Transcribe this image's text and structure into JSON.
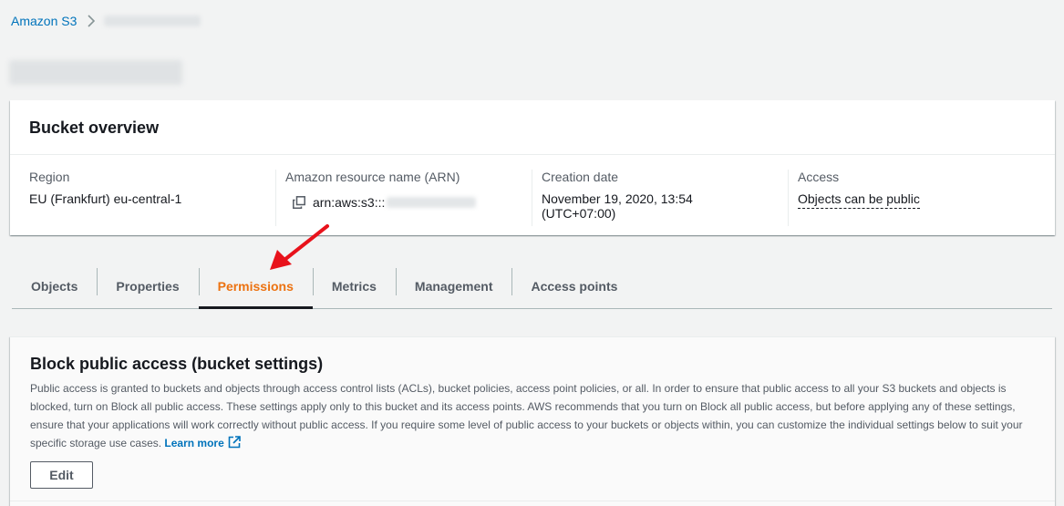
{
  "breadcrumb": {
    "root": "Amazon S3"
  },
  "overview": {
    "title": "Bucket overview",
    "region_label": "Region",
    "region_value": "EU (Frankfurt) eu-central-1",
    "arn_label": "Amazon resource name (ARN)",
    "arn_prefix": "arn:aws:s3:::",
    "date_label": "Creation date",
    "date_value": "November 19, 2020, 13:54 (UTC+07:00)",
    "access_label": "Access",
    "access_value": "Objects can be public"
  },
  "tabs": [
    {
      "label": "Objects"
    },
    {
      "label": "Properties"
    },
    {
      "label": "Permissions"
    },
    {
      "label": "Metrics"
    },
    {
      "label": "Management"
    },
    {
      "label": "Access points"
    }
  ],
  "block_public_access": {
    "title": "Block public access (bucket settings)",
    "description": "Public access is granted to buckets and objects through access control lists (ACLs), bucket policies, access point policies, or all. In order to ensure that public access to all your S3 buckets and objects is blocked, turn on Block all public access. These settings apply only to this bucket and its access points. AWS recommends that you turn on Block all public access, but before applying any of these settings, ensure that your applications will work correctly without public access. If you require some level of public access to your buckets or objects within, you can customize the individual settings below to suit your specific storage use cases.",
    "learn_more": "Learn more",
    "edit_label": "Edit"
  },
  "colors": {
    "link": "#0073bb",
    "active_tab": "#ec7211",
    "annotation_arrow": "#e8121b"
  },
  "icons": {
    "breadcrumb_separator": "chevron-right-icon",
    "copy": "copy-icon",
    "external_link": "external-link-icon",
    "annotation": "red-arrow-icon"
  }
}
